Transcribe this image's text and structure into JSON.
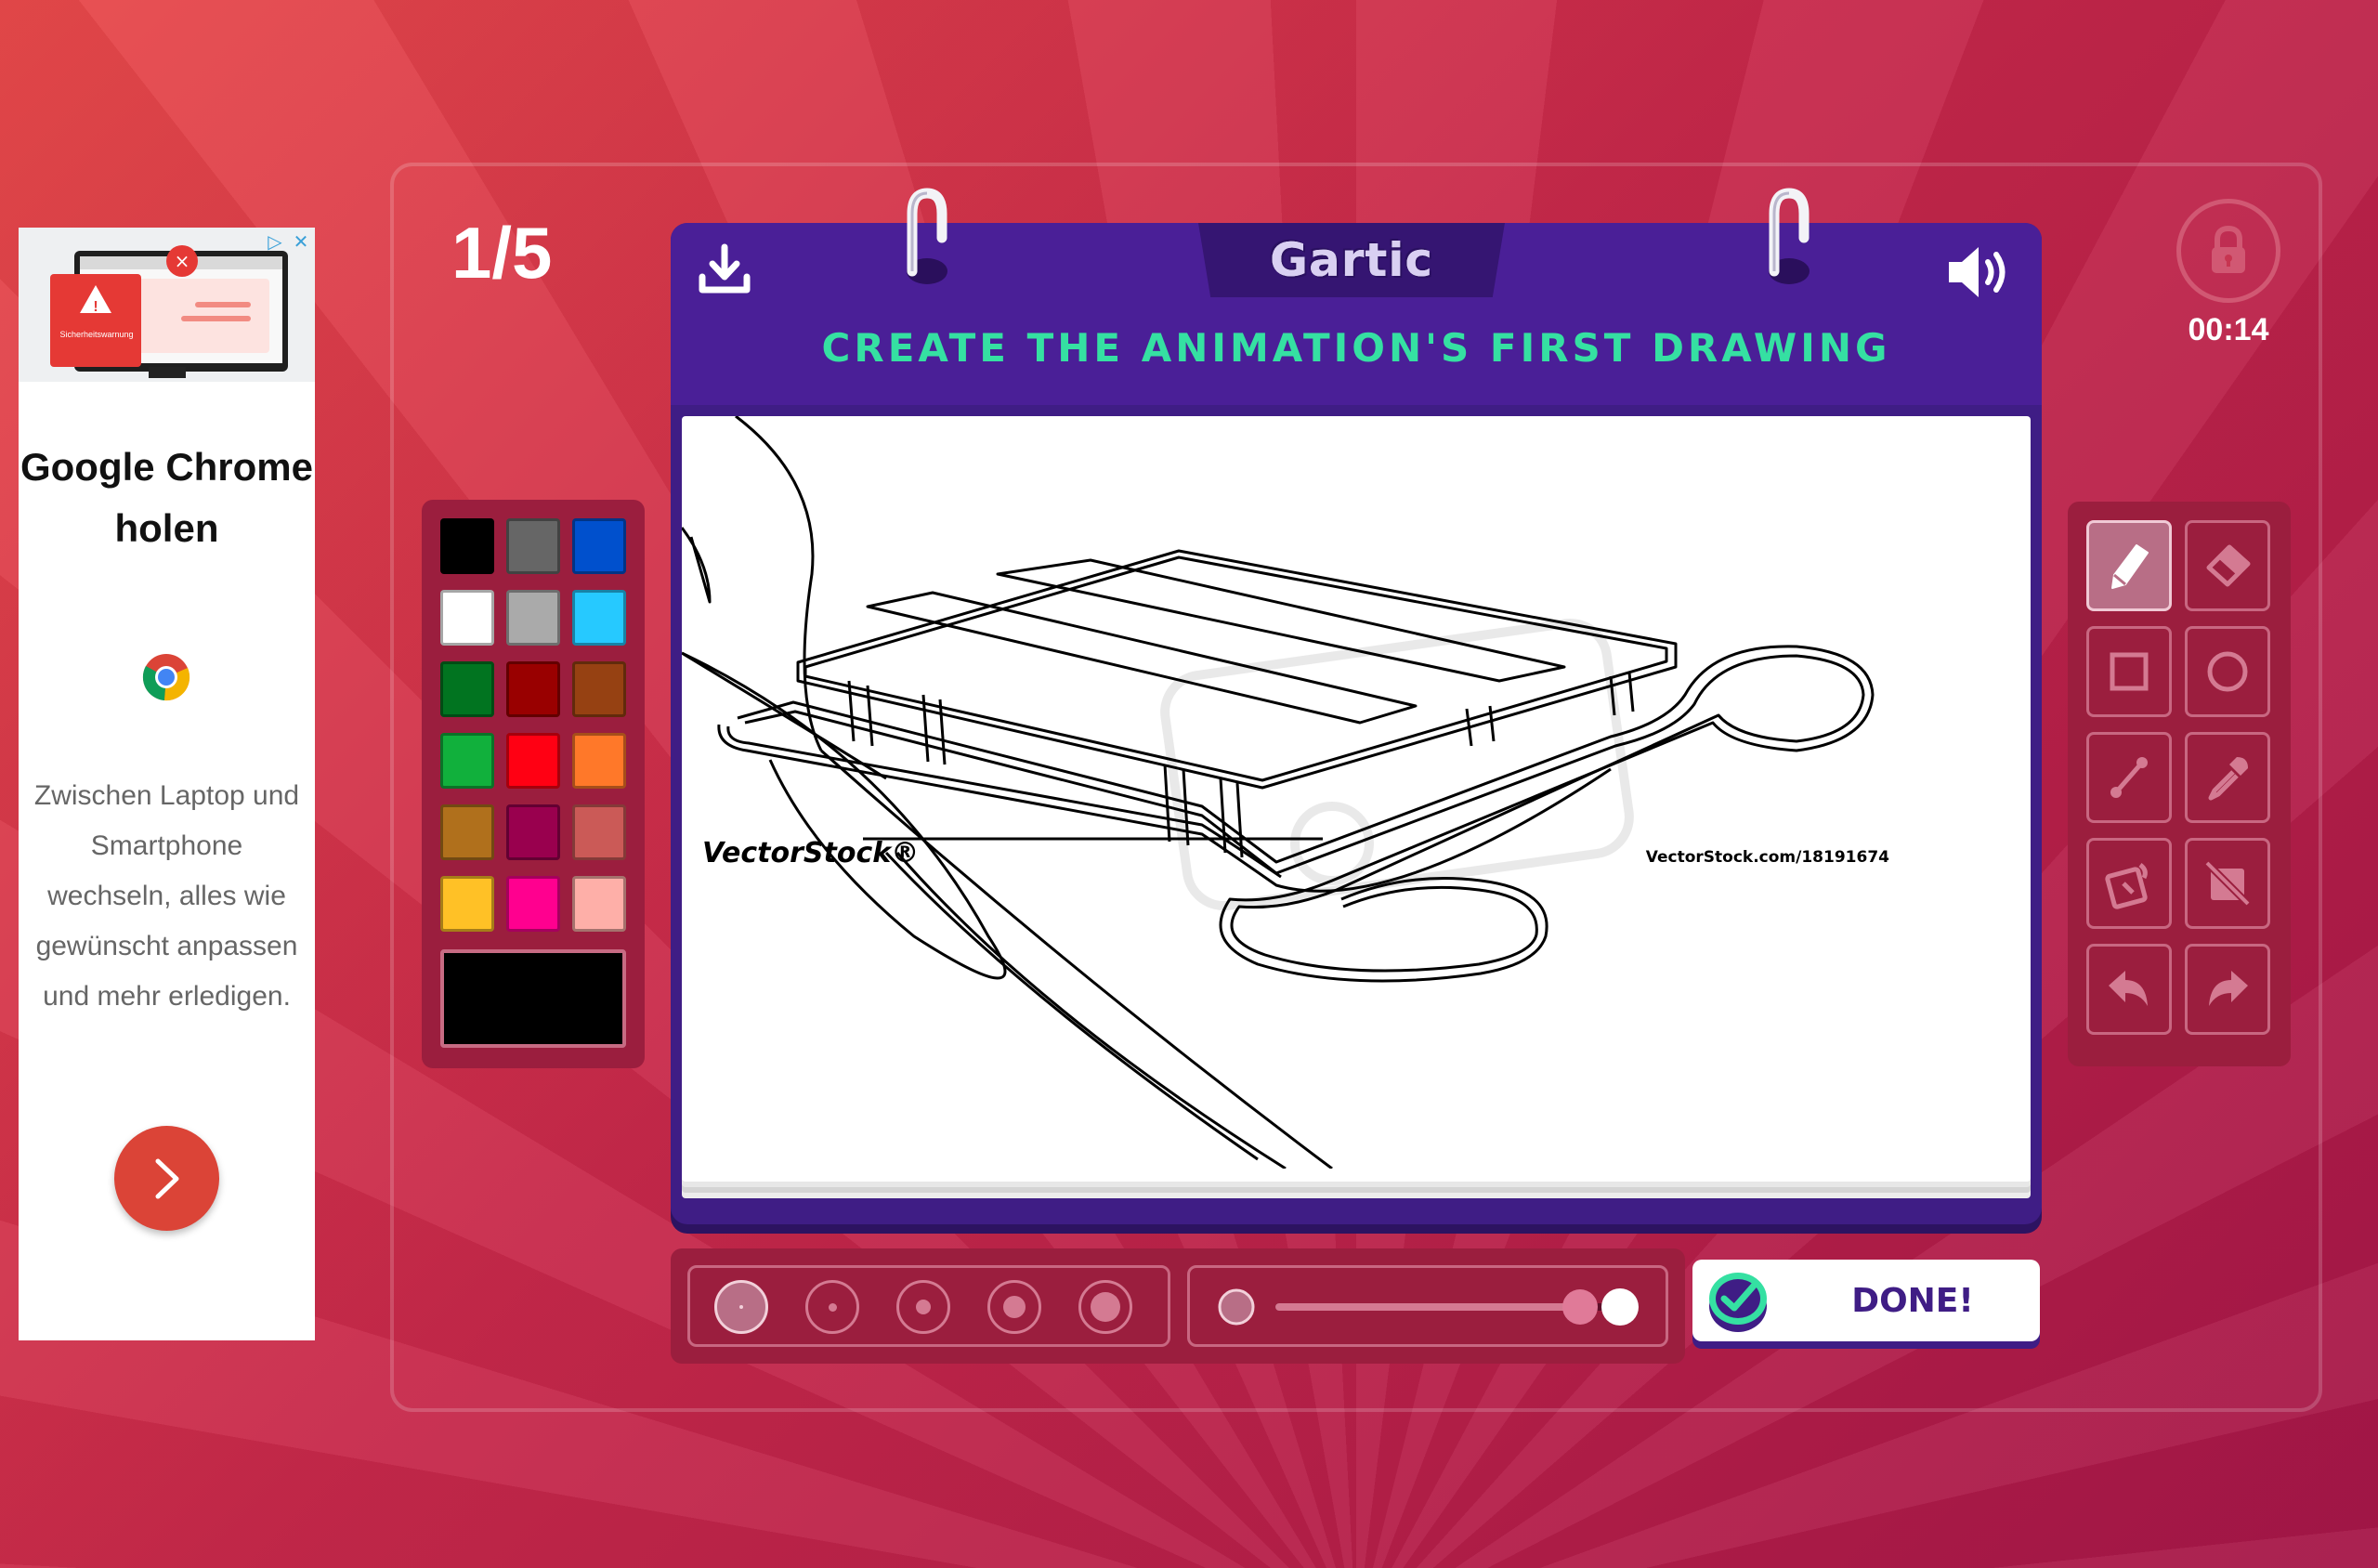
{
  "ad": {
    "warning_text": "Sicherheitswarnung",
    "title": "Google Chrome holen",
    "body": "Zwischen Laptop und Smartphone wechseln, alles wie gewünscht anpassen und mehr erledigen."
  },
  "round": {
    "label": "1/5"
  },
  "timer": {
    "label": "00:14"
  },
  "notebook": {
    "logo": "Gartic",
    "instruction": "CREATE THE ANIMATION'S FIRST DRAWING",
    "watermark_left": "VectorStock®",
    "watermark_right": "VectorStock.com/18191674"
  },
  "palette": {
    "colors": [
      "#000000",
      "#666666",
      "#0050cd",
      "#ffffff",
      "#aaaaaa",
      "#26c9ff",
      "#017420",
      "#990000",
      "#964112",
      "#11b03c",
      "#ff0013",
      "#ff7829",
      "#b0701c",
      "#99004e",
      "#cb5a57",
      "#ffc126",
      "#ff008f",
      "#feafa8"
    ],
    "current": "#000000"
  },
  "tools": [
    "pencil-icon",
    "eraser-icon",
    "rectangle-icon",
    "ellipse-icon",
    "line-icon",
    "eyedropper-icon",
    "fill-icon",
    "no-fill-icon",
    "undo-icon",
    "redo-icon"
  ],
  "active_tool": "pencil",
  "brush_sizes": {
    "count": 5,
    "selected_index": 0
  },
  "opacity": {
    "level": 0.9
  },
  "done": {
    "label": "DONE!"
  }
}
